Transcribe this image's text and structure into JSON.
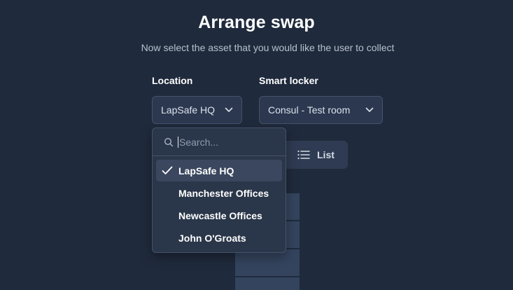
{
  "header": {
    "title": "Arrange swap",
    "subtitle": "Now select the asset that you would like the user to collect"
  },
  "location": {
    "label": "Location",
    "selected": "LapSafe HQ"
  },
  "smart_locker": {
    "label": "Smart locker",
    "selected": "Consul - Test room"
  },
  "view_toggle": {
    "list_label": "List"
  },
  "dropdown": {
    "search_placeholder": "Search...",
    "options": [
      {
        "label": "LapSafe HQ",
        "selected": true
      },
      {
        "label": "Manchester Offices",
        "selected": false
      },
      {
        "label": "Newcastle Offices",
        "selected": false
      },
      {
        "label": "John O'Groats",
        "selected": false
      }
    ]
  },
  "colors": {
    "background": "#1f2a3c",
    "surface": "#2c3850",
    "border": "#46526a",
    "highlight": "#3a475e"
  },
  "icons": {
    "chevron": "chevron-down-icon",
    "search": "search-icon",
    "check": "check-icon",
    "list": "list-icon"
  }
}
